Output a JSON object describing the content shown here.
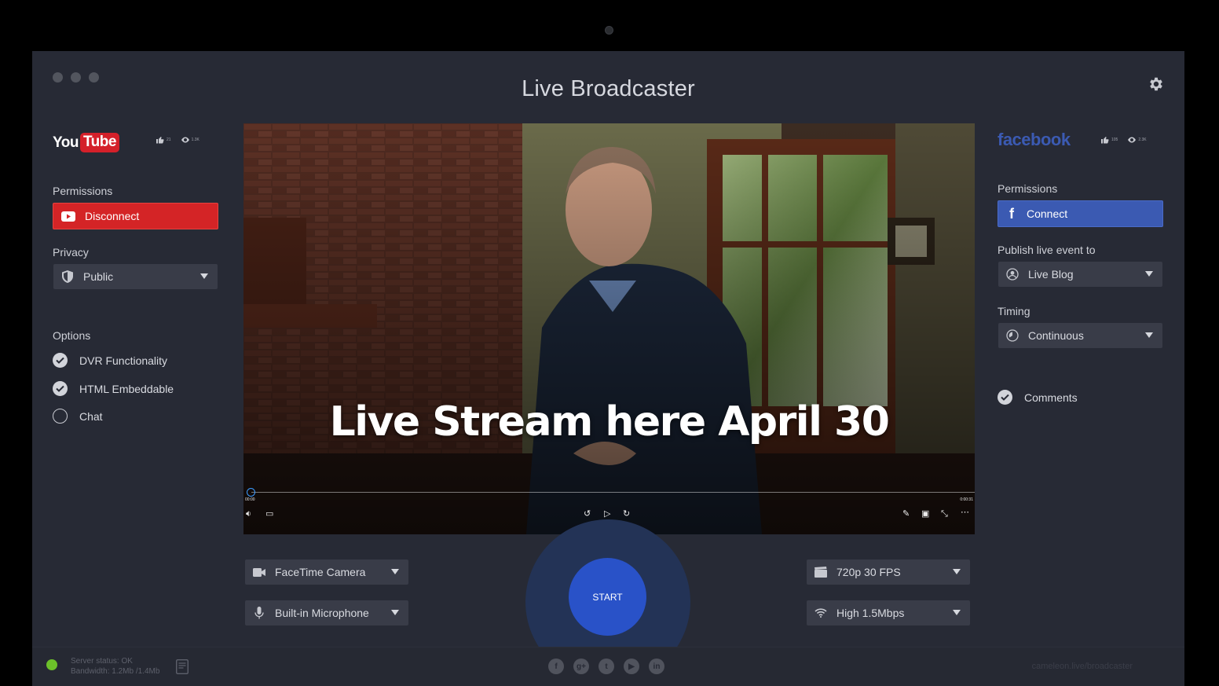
{
  "app": {
    "title": "Live Broadcaster"
  },
  "youtube": {
    "logo_you": "You",
    "logo_tube": "Tube",
    "likes": "21",
    "views": "1.3K",
    "permissions_label": "Permissions",
    "disconnect_label": "Disconnect",
    "privacy_label": "Privacy",
    "privacy_value": "Public",
    "options_label": "Options",
    "options": [
      {
        "label": "DVR Functionality",
        "checked": true
      },
      {
        "label": "HTML Embeddable",
        "checked": true
      },
      {
        "label": "Chat",
        "checked": false
      }
    ]
  },
  "facebook": {
    "logo": "facebook",
    "likes": "105",
    "views": "2.3K",
    "permissions_label": "Permissions",
    "connect_label": "Connect",
    "publish_label": "Publish live event to",
    "publish_value": "Live Blog",
    "timing_label": "Timing",
    "timing_value": "Continuous",
    "comments_label": "Comments",
    "comments_checked": true
  },
  "video": {
    "overlay_text": "Live Stream here April 30",
    "time_start": "00:00",
    "time_end": "0:00:31",
    "progress": 0.0
  },
  "controls": {
    "camera": "FaceTime Camera",
    "microphone": "Built-in Microphone",
    "resolution": "720p 30 FPS",
    "bitrate": "High 1.5Mbps",
    "start_label": "START"
  },
  "footer": {
    "server_status": "Server status: OK",
    "bandwidth": "Bandwidth: 1.2Mb /1.4Mb",
    "url": "cameleon.live/broadcaster",
    "social_icons": [
      "facebook-icon",
      "google-plus-icon",
      "twitter-icon",
      "youtube-icon",
      "linkedin-icon"
    ],
    "status_color": "#6cc02a"
  },
  "colors": {
    "background": "#272a35",
    "youtube_red": "#d42426",
    "facebook_blue": "#3b5ab2",
    "start_blue": "#2952c8"
  }
}
